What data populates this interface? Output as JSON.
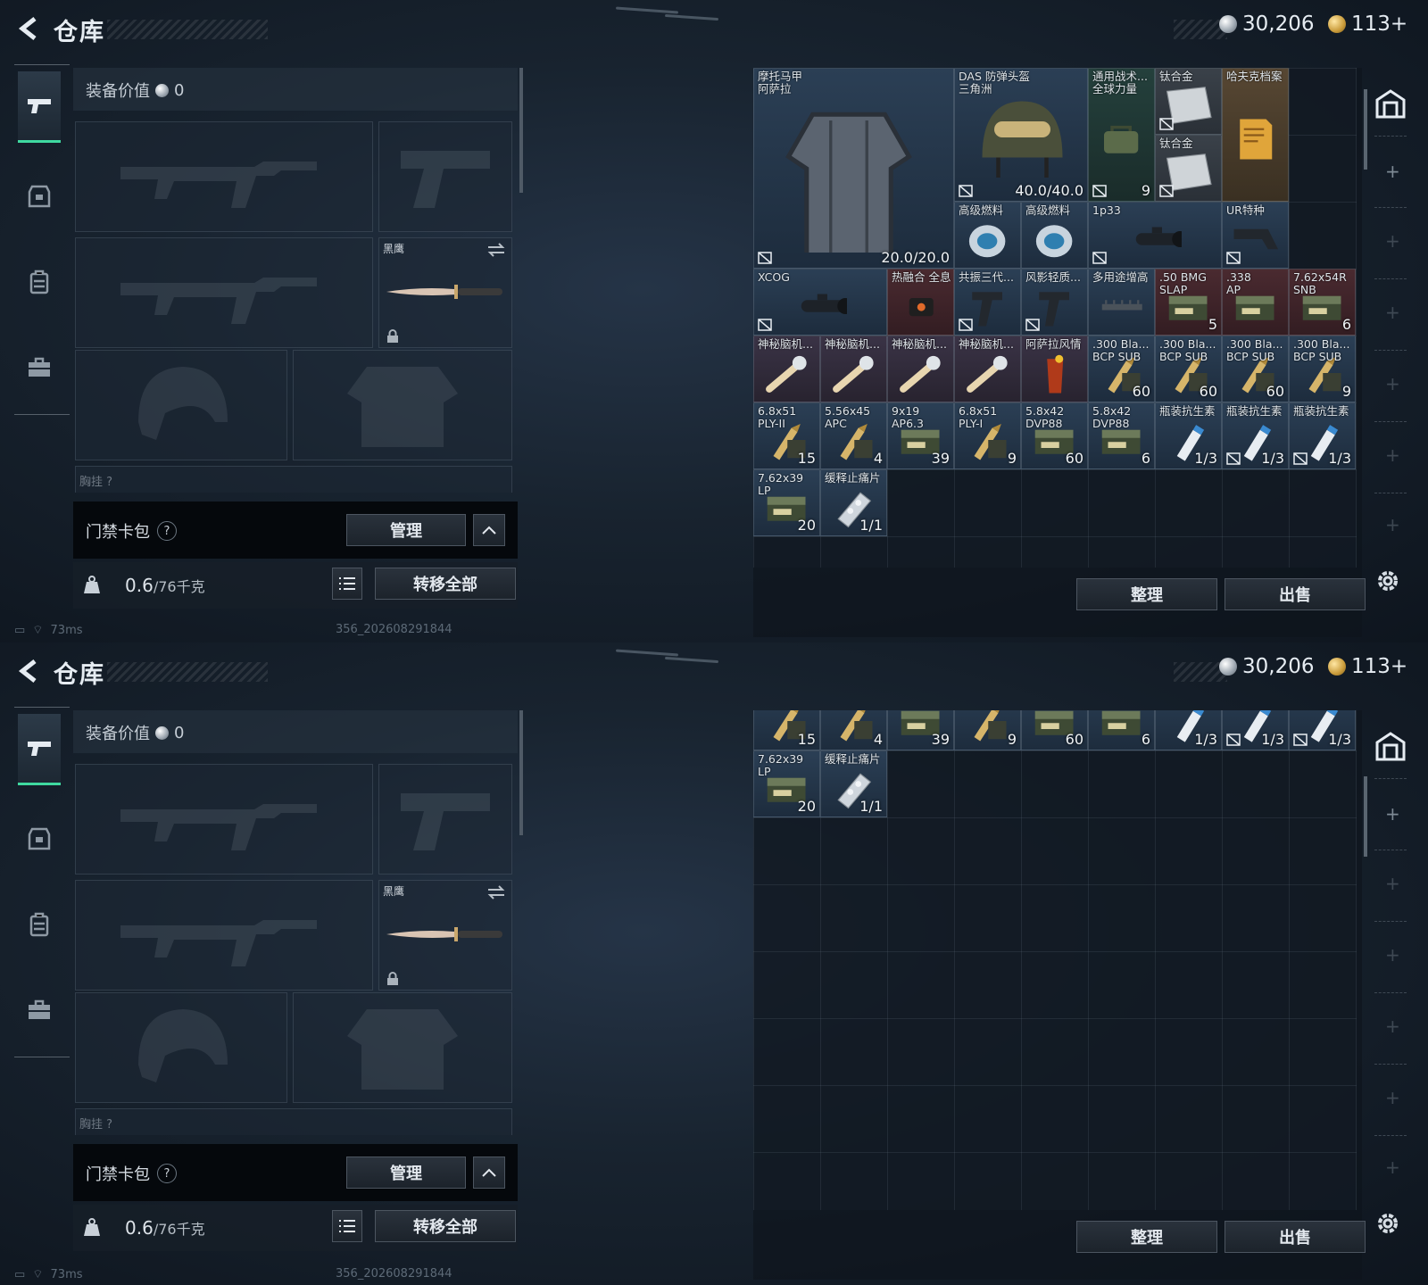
{
  "screens": [
    {
      "title": "仓库",
      "currency": {
        "silver": "30,206",
        "gold": "113+"
      },
      "equipment_value_label": "装备价值",
      "equipment_value": "0",
      "knife_slot_label": "黑鹰",
      "chest_label_partial": "胸挂 ?",
      "keybag_label": "门禁卡包",
      "manage_label": "管理",
      "weight": {
        "value": "0.6",
        "unit": "/76千克"
      },
      "transfer_all_label": "转移全部",
      "sort_label": "整理",
      "sell_label": "出售",
      "status": {
        "ping": "73ms",
        "build": "356_202608291844"
      }
    },
    {
      "title": "仓库",
      "currency": {
        "silver": "30,206",
        "gold": "113+"
      },
      "equipment_value_label": "装备价值",
      "equipment_value": "0",
      "knife_slot_label": "黑鹰",
      "chest_label_partial": "胸挂 ?",
      "keybag_label": "门禁卡包",
      "manage_label": "管理",
      "weight": {
        "value": "0.6",
        "unit": "/76千克"
      },
      "transfer_all_label": "转移全部",
      "sort_label": "整理",
      "sell_label": "出售",
      "status": {
        "ping": "73ms",
        "build": "356_202608291844"
      }
    }
  ],
  "stash_items_top": [
    {
      "name": "摩托马甲\n阿萨拉",
      "count": "20.0/20.0",
      "color": "c-blue",
      "icon": "vest-icon",
      "locked": true
    },
    {
      "name": "DAS 防弹头盔\n三角洲",
      "count": "40.0/40.0",
      "color": "c-blue",
      "icon": "helmet-icon",
      "locked": true
    },
    {
      "name": "通用战术...\n全球力量",
      "count": "9",
      "color": "c-green",
      "icon": "bag-icon",
      "locked": true
    },
    {
      "name": "钛合金",
      "count": "",
      "color": "c-gray",
      "icon": "metal-plate-icon",
      "locked": true
    },
    {
      "name": "钛合金",
      "count": "",
      "color": "c-gray",
      "icon": "metal-plate-icon",
      "locked": true
    },
    {
      "name": "哈夫克档案",
      "count": "",
      "color": "c-gold",
      "icon": "document-icon",
      "locked": false
    },
    {
      "name": "高级燃料",
      "count": "",
      "color": "c-blue",
      "icon": "fuel-can-icon",
      "locked": false
    },
    {
      "name": "高级燃料",
      "count": "",
      "color": "c-blue",
      "icon": "fuel-can-icon",
      "locked": false
    },
    {
      "name": "1p33",
      "count": "",
      "color": "c-blue",
      "icon": "scope-icon",
      "locked": true
    },
    {
      "name": "UR特种",
      "count": "",
      "color": "c-blue",
      "icon": "stock-icon",
      "locked": true
    },
    {
      "name": "XCOG",
      "count": "",
      "color": "c-blue",
      "icon": "scope-icon",
      "locked": true
    },
    {
      "name": "热融合 全息",
      "count": "",
      "color": "c-red",
      "icon": "sight-icon",
      "locked": false
    },
    {
      "name": "共振三代...",
      "count": "",
      "color": "c-blue",
      "icon": "grip-icon",
      "locked": true
    },
    {
      "name": "风影轻质...",
      "count": "",
      "color": "c-blue",
      "icon": "grip-icon",
      "locked": true
    },
    {
      "name": "多用途增高",
      "count": "",
      "color": "c-blue",
      "icon": "rail-icon",
      "locked": false
    },
    {
      "name": ".50 BMG\nSLAP",
      "count": "5",
      "color": "c-red",
      "icon": "ammo-box-icon",
      "locked": false
    },
    {
      "name": ".338\nAP",
      "count": "",
      "color": "c-red",
      "icon": "ammo-box-icon",
      "locked": false
    },
    {
      "name": "7.62x54R\nSNB",
      "count": "6",
      "color": "c-red",
      "icon": "ammo-box-icon",
      "locked": false
    },
    {
      "name": "神秘脑机...",
      "count": "",
      "color": "c-purple",
      "icon": "device-icon",
      "locked": false
    },
    {
      "name": "神秘脑机...",
      "count": "",
      "color": "c-purple",
      "icon": "device-icon",
      "locked": false
    },
    {
      "name": "神秘脑机...",
      "count": "",
      "color": "c-purple",
      "icon": "device-icon",
      "locked": false
    },
    {
      "name": "神秘脑机...",
      "count": "",
      "color": "c-purple",
      "icon": "device-icon",
      "locked": false
    },
    {
      "name": "阿萨拉风情",
      "count": "",
      "color": "c-purple",
      "icon": "drink-icon",
      "locked": false
    },
    {
      "name": ".300 Bla...\nBCP SUB",
      "count": "60",
      "color": "c-blue",
      "icon": "ammo-icon",
      "locked": false
    },
    {
      "name": ".300 Bla...\nBCP SUB",
      "count": "60",
      "color": "c-blue",
      "icon": "ammo-icon",
      "locked": false
    },
    {
      "name": ".300 Bla...\nBCP SUB",
      "count": "60",
      "color": "c-blue",
      "icon": "ammo-icon",
      "locked": false
    },
    {
      "name": ".300 Bla...\nBCP SUB",
      "count": "9",
      "color": "c-blue",
      "icon": "ammo-icon",
      "locked": false
    },
    {
      "name": "6.8x51\nPLY-II",
      "count": "15",
      "color": "c-blue",
      "icon": "ammo-icon",
      "locked": false
    },
    {
      "name": "5.56x45\nAPC",
      "count": "4",
      "color": "c-blue",
      "icon": "ammo-icon",
      "locked": false
    },
    {
      "name": "9x19\nAP6.3",
      "count": "39",
      "color": "c-blue",
      "icon": "ammo-box-icon",
      "locked": false
    },
    {
      "name": "6.8x51\nPLY-I",
      "count": "9",
      "color": "c-blue",
      "icon": "ammo-icon",
      "locked": false
    },
    {
      "name": "5.8x42\nDVP88",
      "count": "60",
      "color": "c-blue",
      "icon": "ammo-box-icon",
      "locked": false
    },
    {
      "name": "5.8x42\nDVP88",
      "count": "6",
      "color": "c-blue",
      "icon": "ammo-box-icon",
      "locked": false
    },
    {
      "name": "瓶装抗生素",
      "count": "1/3",
      "color": "c-blue",
      "icon": "medicine-bottle-icon",
      "locked": false
    },
    {
      "name": "瓶装抗生素",
      "count": "1/3",
      "color": "c-blue",
      "icon": "medicine-bottle-icon",
      "locked": true
    },
    {
      "name": "瓶装抗生素",
      "count": "1/3",
      "color": "c-blue",
      "icon": "medicine-bottle-icon",
      "locked": true
    },
    {
      "name": "7.62x39\nLP",
      "count": "20",
      "color": "c-blue",
      "icon": "ammo-box-icon",
      "locked": false
    },
    {
      "name": "缓释止痛片",
      "count": "1/1",
      "color": "c-blue",
      "icon": "pills-icon",
      "locked": false
    }
  ],
  "stash_items_bottom": [
    {
      "name": "",
      "count": "15",
      "color": "c-blue",
      "icon": "ammo-icon",
      "locked": false
    },
    {
      "name": "",
      "count": "4",
      "color": "c-blue",
      "icon": "ammo-icon",
      "locked": false
    },
    {
      "name": "",
      "count": "39",
      "color": "c-blue",
      "icon": "ammo-box-icon",
      "locked": false
    },
    {
      "name": "",
      "count": "9",
      "color": "c-blue",
      "icon": "ammo-icon",
      "locked": false
    },
    {
      "name": "",
      "count": "60",
      "color": "c-blue",
      "icon": "ammo-box-icon",
      "locked": false
    },
    {
      "name": "",
      "count": "6",
      "color": "c-blue",
      "icon": "ammo-box-icon",
      "locked": false
    },
    {
      "name": "",
      "count": "1/3",
      "color": "c-blue",
      "icon": "medicine-bottle-icon",
      "locked": false
    },
    {
      "name": "",
      "count": "1/3",
      "color": "c-blue",
      "icon": "medicine-bottle-icon",
      "locked": true
    },
    {
      "name": "",
      "count": "1/3",
      "color": "c-blue",
      "icon": "medicine-bottle-icon",
      "locked": true
    },
    {
      "name": "7.62x39\nLP",
      "count": "20",
      "color": "c-blue",
      "icon": "ammo-box-icon",
      "locked": false
    },
    {
      "name": "缓释止痛片",
      "count": "1/1",
      "color": "c-blue",
      "icon": "pills-icon",
      "locked": false
    }
  ]
}
